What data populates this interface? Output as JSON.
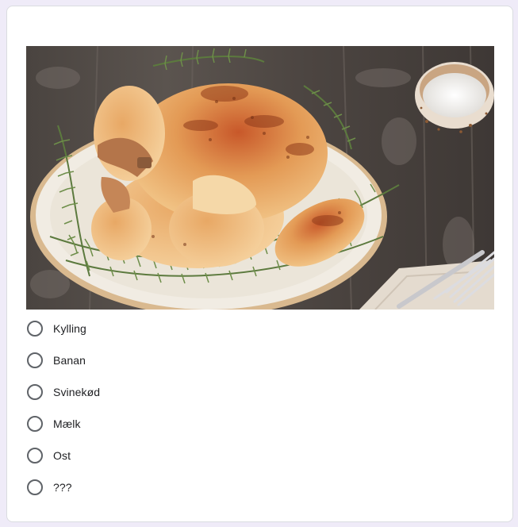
{
  "question": {
    "image": {
      "alt": "",
      "icon": "roast-chicken-photo"
    },
    "options": [
      {
        "label": "Kylling"
      },
      {
        "label": "Banan"
      },
      {
        "label": "Svinekød"
      },
      {
        "label": "Mælk"
      },
      {
        "label": "Ost"
      },
      {
        "label": "???"
      }
    ]
  },
  "colors": {
    "page_background": "#efebf8",
    "card_background": "#ffffff",
    "radio_border": "#5f6368",
    "text": "#202124"
  }
}
